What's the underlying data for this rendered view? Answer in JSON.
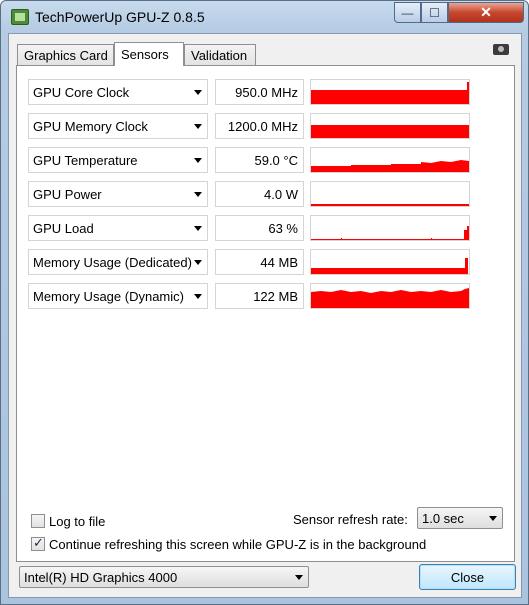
{
  "window": {
    "title": "TechPowerUp GPU-Z 0.8.5",
    "controls": {
      "minimize": "—",
      "maximize": "☐",
      "close": "✕"
    }
  },
  "tabs": [
    {
      "label": "Graphics Card",
      "active": false
    },
    {
      "label": "Sensors",
      "active": true
    },
    {
      "label": "Validation",
      "active": false
    }
  ],
  "icons": {
    "app": "gpu-z-app-icon",
    "camera": "camera-icon"
  },
  "accent": {
    "graph_color": "#ff0000"
  },
  "sensors": [
    {
      "name": "GPU Core Clock",
      "value": "950.0 MHz",
      "graph": "core_clock"
    },
    {
      "name": "GPU Memory Clock",
      "value": "1200.0 MHz",
      "graph": "memory_clock"
    },
    {
      "name": "GPU Temperature",
      "value": "59.0 °C",
      "graph": "temperature"
    },
    {
      "name": "GPU Power",
      "value": "4.0 W",
      "graph": "power"
    },
    {
      "name": "GPU Load",
      "value": "63 %",
      "graph": "load"
    },
    {
      "name": "Memory Usage (Dedicated)",
      "value": "44 MB",
      "graph": "mem_dedicated"
    },
    {
      "name": "Memory Usage (Dynamic)",
      "value": "122 MB",
      "graph": "mem_dynamic"
    }
  ],
  "options": {
    "log_to_file": {
      "label": "Log to file",
      "checked": false
    },
    "refresh_background": {
      "label": "Continue refreshing this screen while GPU-Z is in the background",
      "checked": true
    },
    "refresh_rate_label": "Sensor refresh rate:",
    "refresh_rate_value": "1.0 sec"
  },
  "footer": {
    "gpu_select": "Intel(R) HD Graphics 4000",
    "close_label": "Close"
  }
}
